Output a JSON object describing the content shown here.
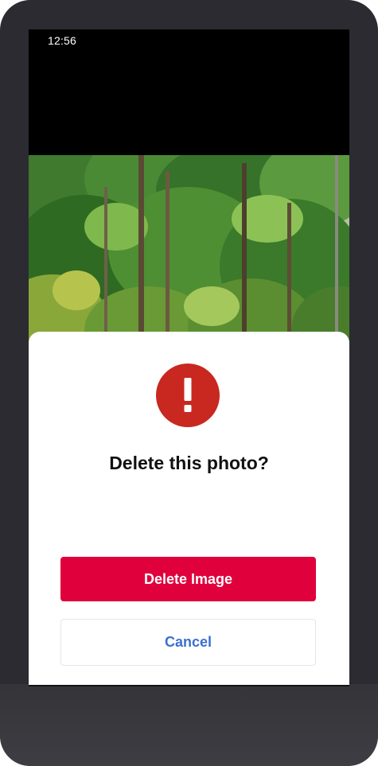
{
  "status_bar": {
    "time": "12:56"
  },
  "dialog": {
    "icon": "alert-circle-icon",
    "title": "Delete this photo?",
    "delete_label": "Delete Image",
    "cancel_label": "Cancel"
  },
  "colors": {
    "alert_red": "#c8281f",
    "delete_button": "#e0003c",
    "cancel_text": "#3a6fd0"
  }
}
